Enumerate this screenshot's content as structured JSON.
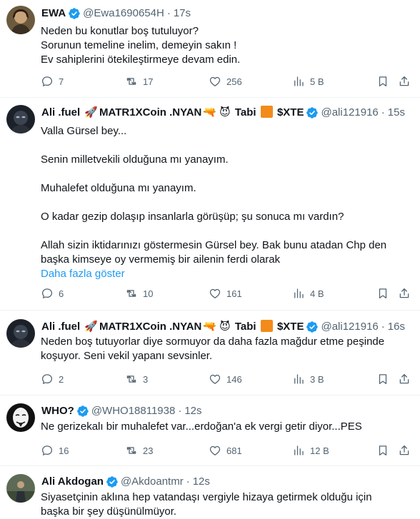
{
  "tweets": [
    {
      "name": "EWA",
      "handle": "@Ewa1690654H",
      "time": "17s",
      "lines": [
        "Neden bu konutlar boş tutuluyor?",
        "Sorunun temeline inelim, demeyin sakın !",
        "Ev sahiplerini ötekileştirmeye devam edin."
      ],
      "replies": "7",
      "retweets": "17",
      "likes": "256",
      "views": "5 B"
    },
    {
      "name": "Ali .fuel",
      "name_rest": "MATR1XCoin .NYAN",
      "name_tail": "Tabi",
      "name_ticker": "$XTE",
      "handle": "@ali121916",
      "time": "15s",
      "paragraphs": [
        "Valla Gürsel bey...",
        "Senin milletvekili olduğuna mı yanayım.",
        "Muhalefet olduğuna mı yanayım.",
        "O kadar gezip dolaşıp insanlarla görüşüp; şu sonuca mı vardın?",
        "Allah sizin iktidarınızı göstermesin Gürsel bey. Bak bunu atadan Chp den başka kimseye oy vermemiş bir ailenin ferdi olarak"
      ],
      "show_more": "Daha fazla göster",
      "replies": "6",
      "retweets": "10",
      "likes": "161",
      "views": "4 B"
    },
    {
      "name": "Ali .fuel",
      "name_rest": "MATR1XCoin .NYAN",
      "name_tail": "Tabi",
      "name_ticker": "$XTE",
      "handle": "@ali121916",
      "time": "16s",
      "lines": [
        "Neden boş tutuyorlar diye sormuyor da daha fazla mağdur etme peşinde",
        "koşuyor. Seni vekil yapanı sevsinler."
      ],
      "replies": "2",
      "retweets": "3",
      "likes": "146",
      "views": "3 B"
    },
    {
      "name": "WHO?",
      "handle": "@WHO18811938",
      "time": "12s",
      "lines": [
        "Ne gerizekalı bir muhalefet var...erdoğan'a ek vergi getir diyor...PES"
      ],
      "replies": "16",
      "retweets": "23",
      "likes": "681",
      "views": "12 B"
    },
    {
      "name": "Ali Akdogan",
      "handle": "@Akdoantmr",
      "time": "12s",
      "lines": [
        "Siyasetçinin aklına hep vatandaşı vergiyle hizaya getirmek olduğu için",
        "başka bir şey düşünülmüyor."
      ]
    }
  ],
  "colors": {
    "verified": "#1d9bf0",
    "muted": "#536471",
    "text": "#0f1419",
    "link": "#1d9bf0"
  },
  "icons": [
    "reply-icon",
    "retweet-icon",
    "like-icon",
    "views-icon",
    "bookmark-icon",
    "share-icon",
    "verified-badge-icon"
  ]
}
